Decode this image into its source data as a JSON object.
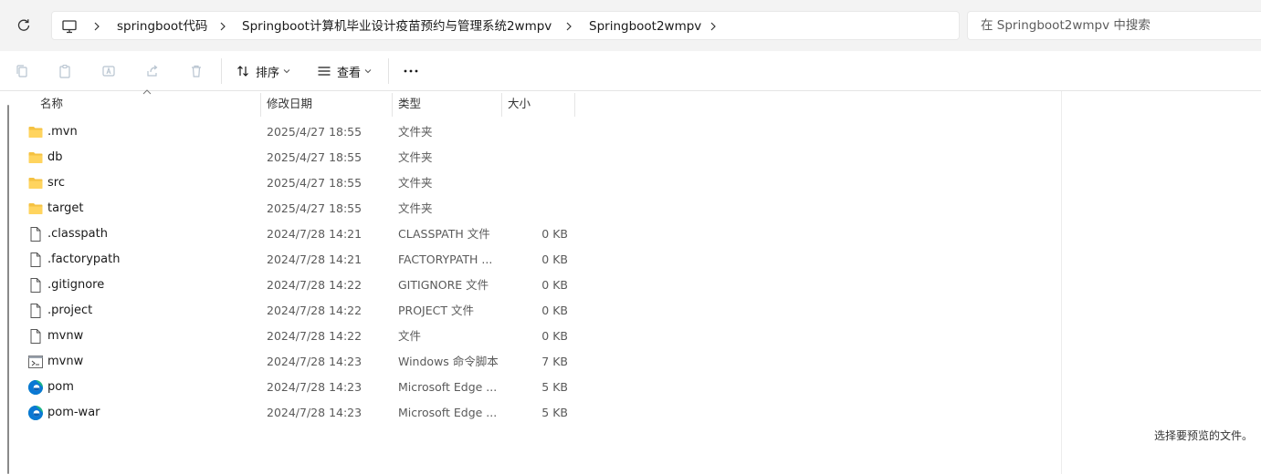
{
  "address_bar": {
    "breadcrumbs": [
      "springboot代码",
      "Springboot计算机毕业设计疫苗预约与管理系统2wmpv",
      "Springboot2wmpv"
    ]
  },
  "search": {
    "placeholder": "在 Springboot2wmpv 中搜索"
  },
  "toolbar": {
    "sort_label": "排序",
    "view_label": "查看"
  },
  "columns": {
    "name": "名称",
    "date": "修改日期",
    "type": "类型",
    "size": "大小"
  },
  "files": [
    {
      "name": ".mvn",
      "date": "2025/4/27 18:55",
      "type": "文件夹",
      "size": "",
      "icon": "folder-icon"
    },
    {
      "name": "db",
      "date": "2025/4/27 18:55",
      "type": "文件夹",
      "size": "",
      "icon": "folder-icon"
    },
    {
      "name": "src",
      "date": "2025/4/27 18:55",
      "type": "文件夹",
      "size": "",
      "icon": "folder-icon"
    },
    {
      "name": "target",
      "date": "2025/4/27 18:55",
      "type": "文件夹",
      "size": "",
      "icon": "folder-icon"
    },
    {
      "name": ".classpath",
      "date": "2024/7/28 14:21",
      "type": "CLASSPATH 文件",
      "size": "0 KB",
      "icon": "file-icon"
    },
    {
      "name": ".factorypath",
      "date": "2024/7/28 14:21",
      "type": "FACTORYPATH ...",
      "size": "0 KB",
      "icon": "file-icon"
    },
    {
      "name": ".gitignore",
      "date": "2024/7/28 14:22",
      "type": "GITIGNORE 文件",
      "size": "0 KB",
      "icon": "file-icon"
    },
    {
      "name": ".project",
      "date": "2024/7/28 14:22",
      "type": "PROJECT 文件",
      "size": "0 KB",
      "icon": "file-icon"
    },
    {
      "name": "mvnw",
      "date": "2024/7/28 14:22",
      "type": "文件",
      "size": "0 KB",
      "icon": "file-icon"
    },
    {
      "name": "mvnw",
      "date": "2024/7/28 14:23",
      "type": "Windows 命令脚本",
      "size": "7 KB",
      "icon": "script-icon"
    },
    {
      "name": "pom",
      "date": "2024/7/28 14:23",
      "type": "Microsoft Edge ...",
      "size": "5 KB",
      "icon": "edge-icon"
    },
    {
      "name": "pom-war",
      "date": "2024/7/28 14:23",
      "type": "Microsoft Edge ...",
      "size": "5 KB",
      "icon": "edge-icon"
    }
  ],
  "preview": {
    "text": "选择要预览的文件。"
  },
  "colors": {
    "folder": "#f5c242",
    "accent": "#0067c0"
  }
}
